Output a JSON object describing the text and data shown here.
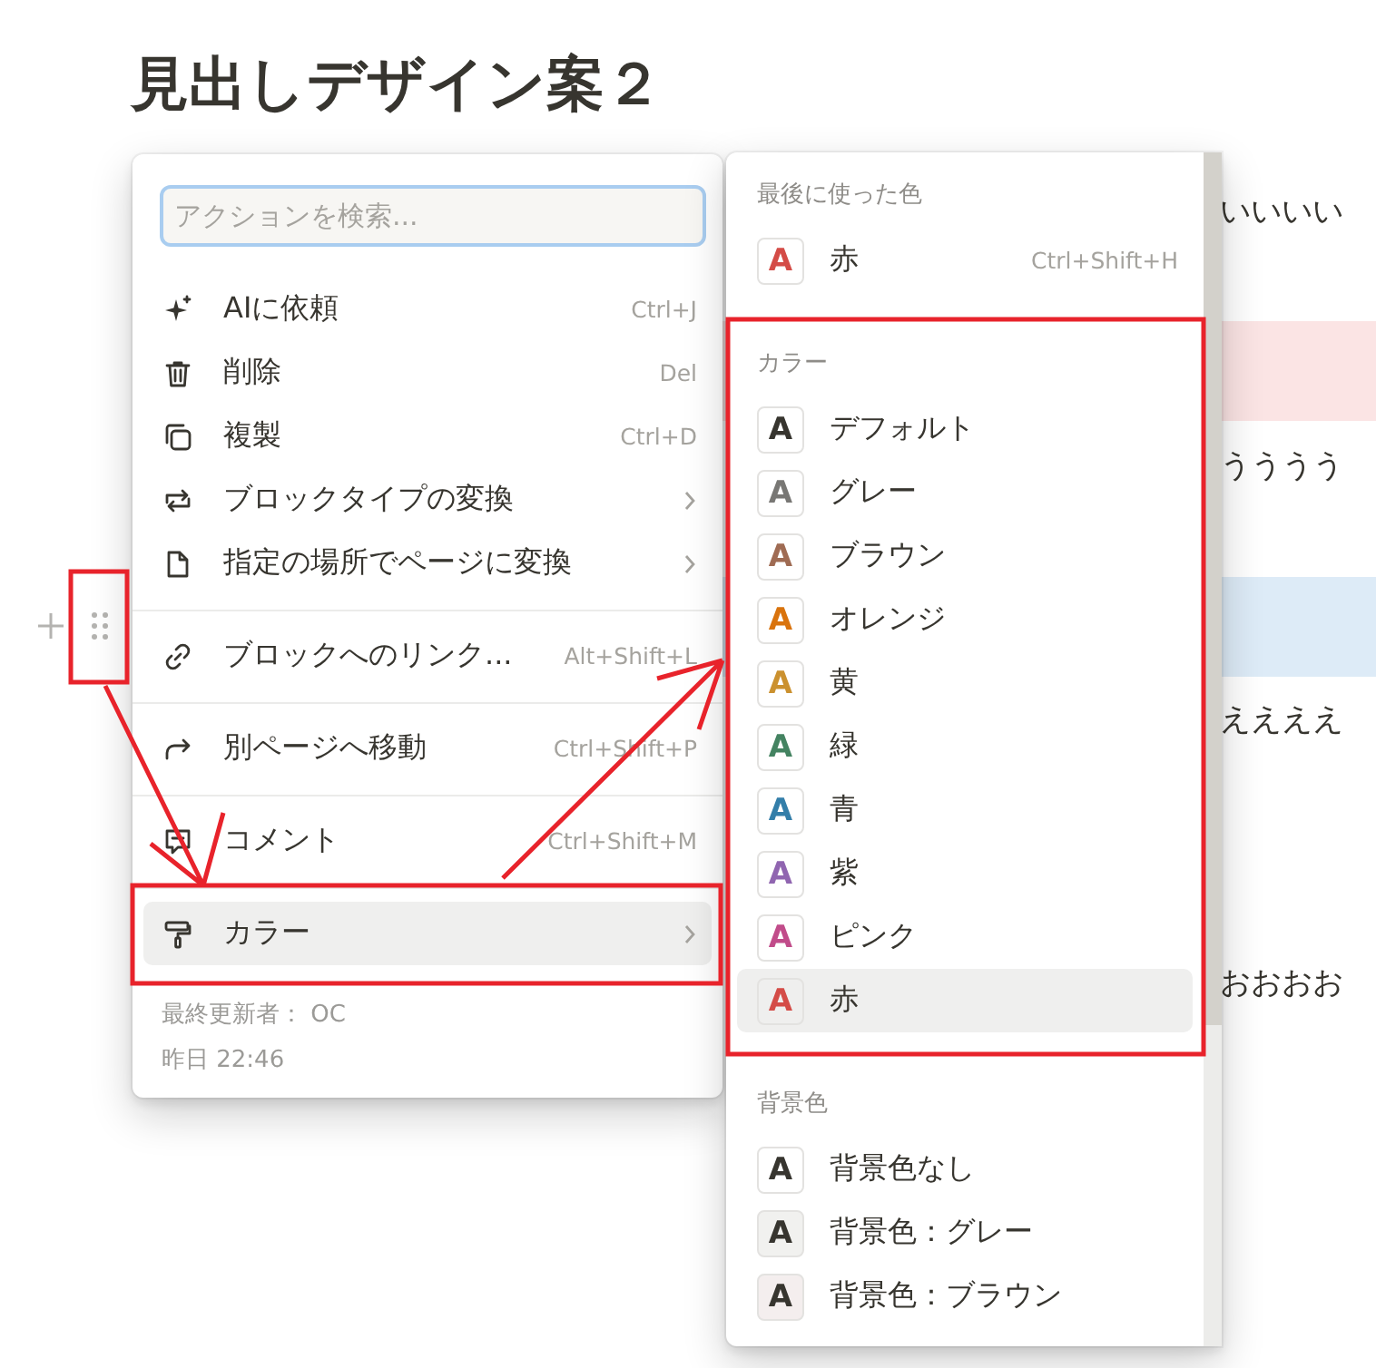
{
  "page": {
    "title": "見出しデザイン案２",
    "blocks": [
      {
        "kind": "text",
        "text": "いいいい"
      },
      {
        "kind": "colored",
        "color": "#fbe4e4"
      },
      {
        "kind": "text",
        "text": "うううう"
      },
      {
        "kind": "colored",
        "color": "#ddebf7"
      },
      {
        "kind": "text",
        "text": "ええええ"
      },
      {
        "kind": "text",
        "text": "おおおお"
      }
    ]
  },
  "action_menu": {
    "search": {
      "placeholder": "アクションを検索..."
    },
    "groups": [
      [
        {
          "label": "AIに依頼",
          "shortcut": "Ctrl+J",
          "has_submenu": false,
          "selected": false
        },
        {
          "label": "削除",
          "shortcut": "Del",
          "has_submenu": false,
          "selected": false
        },
        {
          "label": "複製",
          "shortcut": "Ctrl+D",
          "has_submenu": false,
          "selected": false
        },
        {
          "label": "ブロックタイプの変換",
          "has_submenu": true,
          "selected": false
        },
        {
          "label": "指定の場所でページに変換",
          "has_submenu": true,
          "selected": false
        }
      ],
      [
        {
          "label": "ブロックへのリンク...",
          "shortcut": "Alt+Shift+L",
          "has_submenu": false,
          "selected": false
        }
      ],
      [
        {
          "label": "別ページへ移動",
          "shortcut": "Ctrl+Shift+P",
          "has_submenu": false,
          "selected": false
        }
      ],
      [
        {
          "label": "コメント",
          "shortcut": "Ctrl+Shift+M",
          "has_submenu": false,
          "selected": false
        }
      ],
      [
        {
          "label": "カラー",
          "has_submenu": true,
          "selected": true
        }
      ]
    ],
    "footer": [
      "最終更新者： OC",
      "昨日 22:46"
    ]
  },
  "color_menu": {
    "sections": [
      {
        "heading": "最後に使った色",
        "items": [
          {
            "kind": "text-color",
            "glyph": "A",
            "label": "赤",
            "color": "#d44c47",
            "shortcut": "Ctrl+Shift+H",
            "selected": false
          }
        ]
      },
      {
        "heading": "カラー",
        "items": [
          {
            "kind": "text-color",
            "glyph": "A",
            "label": "デフォルト",
            "color": "#37352f",
            "selected": false
          },
          {
            "kind": "text-color",
            "glyph": "A",
            "label": "グレー",
            "color": "#787774",
            "selected": false
          },
          {
            "kind": "text-color",
            "glyph": "A",
            "label": "ブラウン",
            "color": "#9f6b53",
            "selected": false
          },
          {
            "kind": "text-color",
            "glyph": "A",
            "label": "オレンジ",
            "color": "#d9730d",
            "selected": false
          },
          {
            "kind": "text-color",
            "glyph": "A",
            "label": "黄",
            "color": "#cb912f",
            "selected": false
          },
          {
            "kind": "text-color",
            "glyph": "A",
            "label": "緑",
            "color": "#448361",
            "selected": false
          },
          {
            "kind": "text-color",
            "glyph": "A",
            "label": "青",
            "color": "#337ea9",
            "selected": false
          },
          {
            "kind": "text-color",
            "glyph": "A",
            "label": "紫",
            "color": "#9065b0",
            "selected": false
          },
          {
            "kind": "text-color",
            "glyph": "A",
            "label": "ピンク",
            "color": "#c14c8a",
            "selected": false
          },
          {
            "kind": "text-color",
            "glyph": "A",
            "label": "赤",
            "color": "#d44c47",
            "selected": true
          }
        ]
      },
      {
        "heading": "背景色",
        "items": [
          {
            "kind": "background",
            "glyph": "A",
            "label": "背景色なし",
            "color": "#ffffff",
            "selected": false
          },
          {
            "kind": "background",
            "glyph": "A",
            "label": "背景色：グレー",
            "color": "#f1f1ef",
            "selected": false
          },
          {
            "kind": "background",
            "glyph": "A",
            "label": "背景色：ブラウン",
            "color": "#f4eeee",
            "selected": false
          }
        ]
      }
    ]
  }
}
